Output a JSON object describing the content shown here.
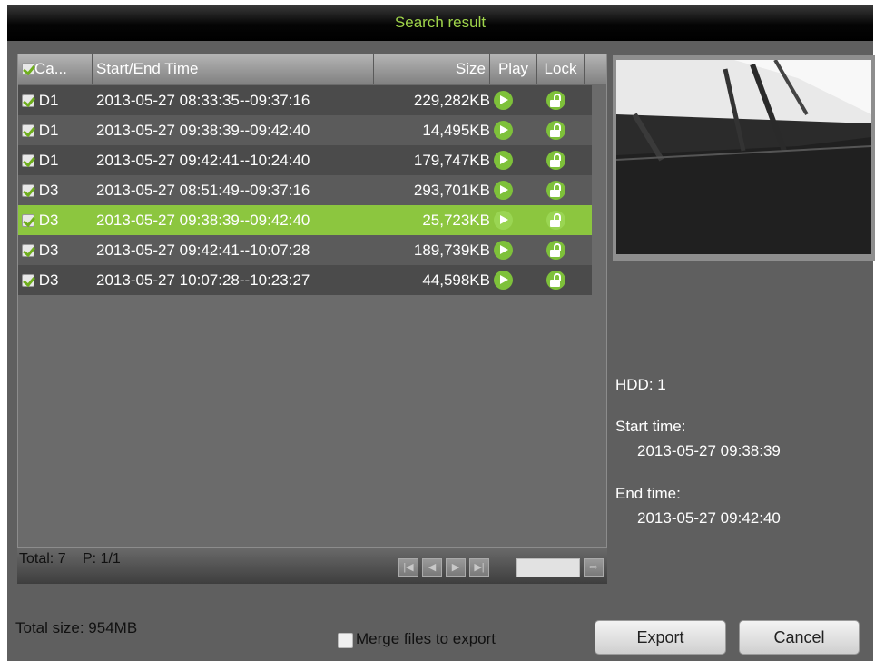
{
  "title": "Search result",
  "table": {
    "columns": {
      "camera": "Ca...",
      "time": "Start/End Time",
      "size": "Size",
      "play": "Play",
      "lock": "Lock"
    },
    "rows": [
      {
        "camera": "D1",
        "time": "2013-05-27 08:33:35--09:37:16",
        "size": "229,282KB",
        "checked": true
      },
      {
        "camera": "D1",
        "time": "2013-05-27 09:38:39--09:42:40",
        "size": "14,495KB",
        "checked": true
      },
      {
        "camera": "D1",
        "time": "2013-05-27 09:42:41--10:24:40",
        "size": "179,747KB",
        "checked": true
      },
      {
        "camera": "D3",
        "time": "2013-05-27 08:51:49--09:37:16",
        "size": "293,701KB",
        "checked": true
      },
      {
        "camera": "D3",
        "time": "2013-05-27 09:38:39--09:42:40",
        "size": "25,723KB",
        "checked": true,
        "selected": true
      },
      {
        "camera": "D3",
        "time": "2013-05-27 09:42:41--10:07:28",
        "size": "189,739KB",
        "checked": true
      },
      {
        "camera": "D3",
        "time": "2013-05-27 10:07:28--10:23:27",
        "size": "44,598KB",
        "checked": true
      }
    ]
  },
  "pager": {
    "total": "Total: 7",
    "page": "P: 1/1",
    "page_input": ""
  },
  "info": {
    "hdd": "HDD: 1",
    "start_label": "Start time:",
    "start_value": "2013-05-27 09:38:39",
    "end_label": "End time:",
    "end_value": "2013-05-27 09:42:40"
  },
  "footer": {
    "total_size": "Total size: 954MB",
    "merge_label": "Merge files to export",
    "merge_checked": false,
    "export": "Export",
    "cancel": "Cancel"
  },
  "colors": {
    "accent": "#8cc63f",
    "title_text": "#9fd44a",
    "panel_bg": "#5f5f5f"
  }
}
